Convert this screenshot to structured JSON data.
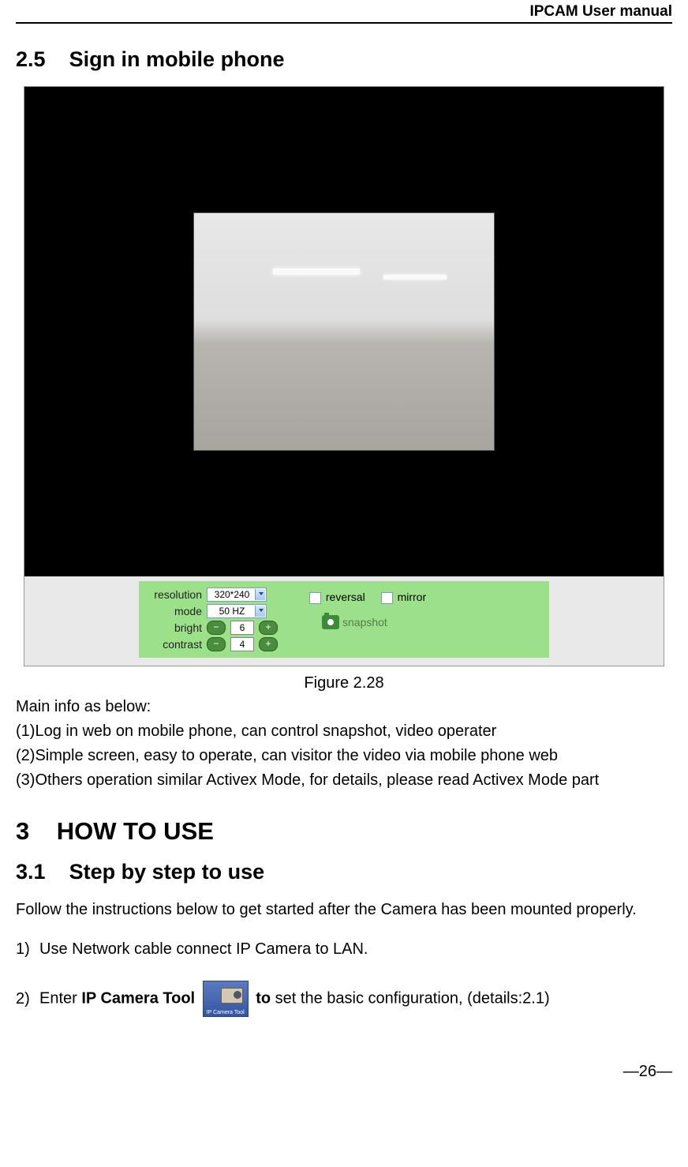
{
  "header": {
    "title": "IPCAM User manual"
  },
  "section_2_5": {
    "number": "2.5",
    "title": "Sign in mobile phone"
  },
  "figure": {
    "caption": "Figure 2.28",
    "controls": {
      "resolution_label": "resolution",
      "resolution_value": "320*240",
      "mode_label": "mode",
      "mode_value": "50 HZ",
      "bright_label": "bright",
      "bright_value": "6",
      "contrast_label": "contrast",
      "contrast_value": "4",
      "reversal_label": "reversal",
      "mirror_label": "mirror",
      "snapshot_label": "snapshot"
    }
  },
  "main_info": {
    "intro": "Main info as below:",
    "item1": "(1)Log in web on mobile phone, can control snapshot, video operater",
    "item2": "(2)Simple screen, easy to operate, can visitor the video via mobile phone web",
    "item3": "(3)Others operation similar Activex Mode, for details, please read Activex Mode part"
  },
  "chapter_3": {
    "number": "3",
    "title": "HOW TO USE"
  },
  "section_3_1": {
    "number": "3.1",
    "title": "Step by step to use",
    "intro": "Follow the instructions below to get started after the Camera has been mounted properly."
  },
  "steps": {
    "s1_num": "1)",
    "s1_text": "Use Network cable connect IP Camera to LAN.",
    "s2_num": "2)",
    "s2_prefix": "Enter ",
    "s2_tool_bold": "IP Camera Tool ",
    "s2_icon_label": "IP Camera Tool",
    "s2_to_bold": " to ",
    "s2_suffix": "set the basic configuration, (details:2.1)"
  },
  "page_number": "—26—"
}
